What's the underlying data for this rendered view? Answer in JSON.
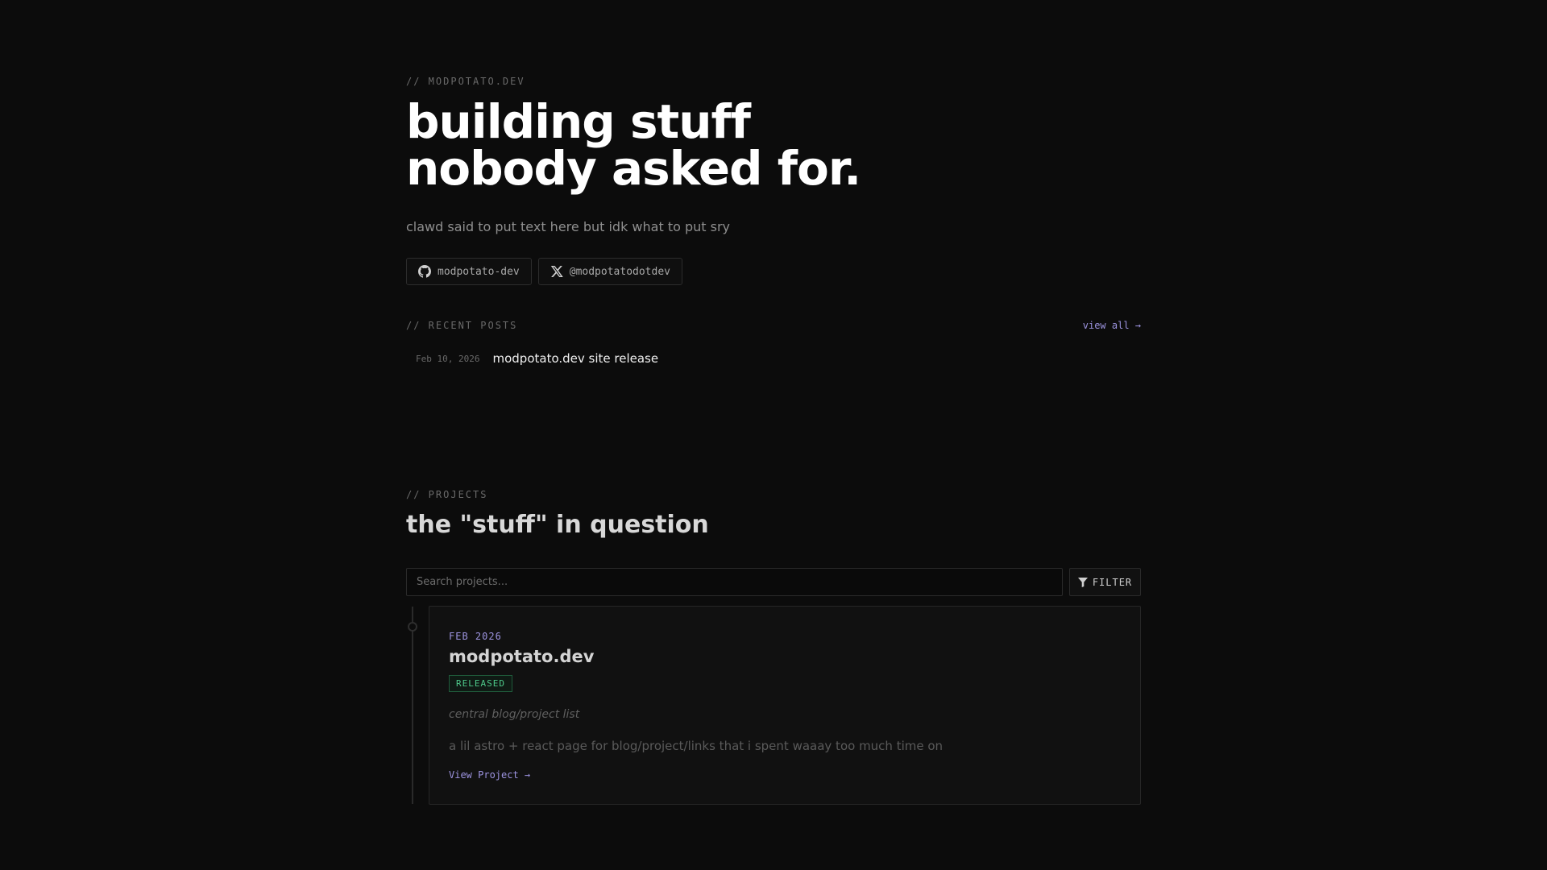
{
  "hero": {
    "eyebrow": "// MODPOTATO.DEV",
    "title_line1": "building stuff",
    "title_line2": "nobody asked for.",
    "subtitle": "clawd said to put text here but idk what to put sry"
  },
  "socials": [
    {
      "label": "modpotato-dev",
      "icon": "github-icon"
    },
    {
      "label": "@modpotatodotdev",
      "icon": "x-icon"
    }
  ],
  "recent_posts": {
    "eyebrow": "// RECENT POSTS",
    "view_all": "view all →",
    "items": [
      {
        "date": "Feb 10, 2026",
        "title": "modpotato.dev site release"
      }
    ]
  },
  "projects": {
    "eyebrow": "// PROJECTS",
    "title": "the \"stuff\" in question",
    "search_placeholder": "Search projects...",
    "filter_label": "FILTER",
    "items": [
      {
        "date": "FEB 2026",
        "title": "modpotato.dev",
        "status": "RELEASED",
        "tagline": "central blog/project list",
        "description": "a lil astro + react page for blog/project/links that i spent waaay too much time on",
        "link_label": "View Project →"
      }
    ]
  },
  "colors": {
    "background": "#0c0c0c",
    "accent": "#9d94e0",
    "released": "#4ec98a"
  }
}
